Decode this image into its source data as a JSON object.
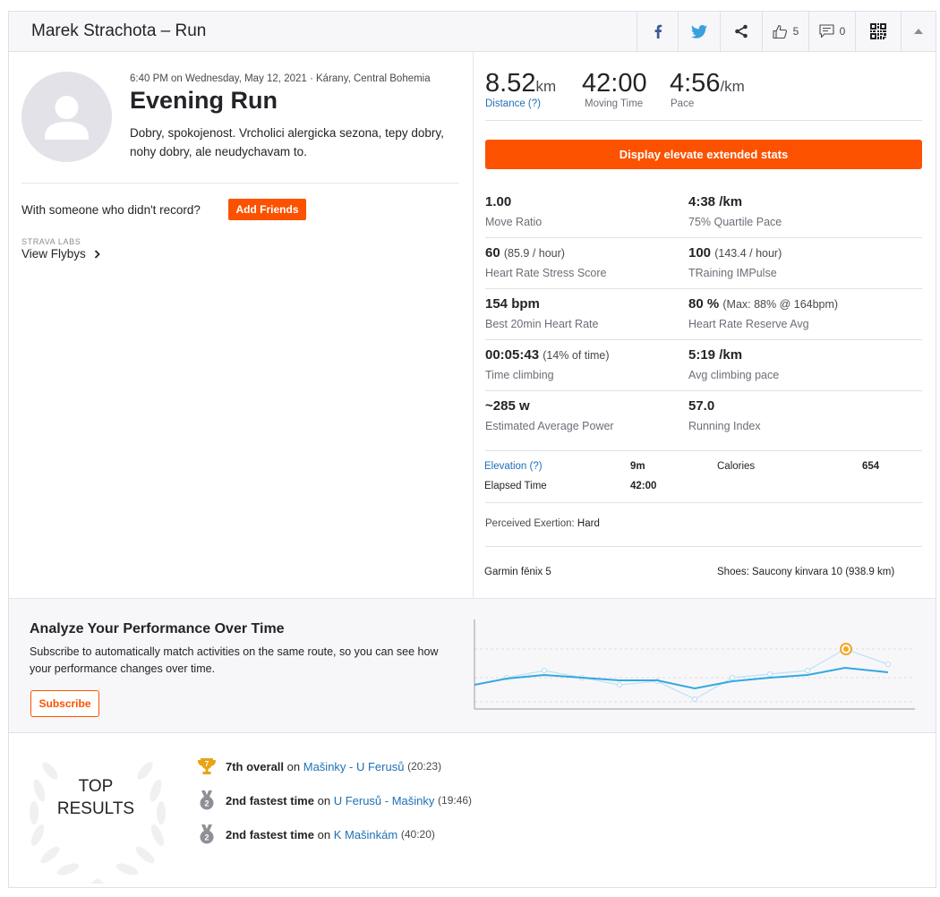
{
  "header": {
    "title": "Marek Strachota – Run",
    "kudos_count": "5",
    "comments_count": "0"
  },
  "activity": {
    "time": "6:40 PM",
    "on": "on",
    "date": "Wednesday, May 12, 2021",
    "location": "· Kárany, Central Bohemia",
    "title": "Evening Run",
    "description": "Dobry, spokojenost. Vrcholici alergicka sezona, tepy dobry, nohy dobry, ale neudychavam to."
  },
  "friends": {
    "prompt": "With someone who didn't record?",
    "add_button": "Add Friends",
    "labs_label": "STRAVA LABS",
    "flybys_link": "View Flybys"
  },
  "primary_stats": [
    {
      "value": "8.52",
      "unit": "km",
      "label": "Distance (?)"
    },
    {
      "value": "42:00",
      "unit": "",
      "label": "Moving Time"
    },
    {
      "value": "4:56",
      "unit": "/km",
      "label": "Pace"
    }
  ],
  "elevate_button": "Display elevate extended stats",
  "extended_stats": [
    {
      "value": "1.00",
      "sub": "",
      "label": "Move Ratio"
    },
    {
      "value": "4:38 /km",
      "sub": "",
      "label": "75% Quartile Pace"
    },
    {
      "value": "60",
      "sub": "(85.9 / hour)",
      "label": "Heart Rate Stress Score"
    },
    {
      "value": "100",
      "sub": "(143.4 / hour)",
      "label": "TRaining IMPulse"
    },
    {
      "value": "154 bpm",
      "sub": "",
      "label": "Best 20min Heart Rate"
    },
    {
      "value": "80 %",
      "sub": "(Max: 88% @ 164bpm)",
      "label": "Heart Rate Reserve Avg"
    },
    {
      "value": "00:05:43",
      "sub": "(14% of time)",
      "label": "Time climbing"
    },
    {
      "value": "5:19 /km",
      "sub": "",
      "label": "Avg climbing pace"
    },
    {
      "value": "~285 w",
      "sub": "",
      "label": "Estimated Average Power"
    },
    {
      "value": "57.0",
      "sub": "",
      "label": "Running Index"
    }
  ],
  "secondary_stats": {
    "elevation_label": "Elevation (?)",
    "elevation_value": "9m",
    "calories_label": "Calories",
    "calories_value": "654",
    "elapsed_label": "Elapsed Time",
    "elapsed_value": "42:00",
    "exertion_label": "Perceived Exertion:",
    "exertion_value": "Hard",
    "device": "Garmin fēnix 5",
    "shoes": "Shoes: Saucony kinvara 10 (938.9 km)"
  },
  "analyze": {
    "title": "Analyze Your Performance Over Time",
    "text": "Subscribe to automatically match activities on the same route, so you can see how your performance changes over time.",
    "button": "Subscribe"
  },
  "top_results": {
    "heading_line1": "TOP",
    "heading_line2": "RESULTS",
    "items": [
      {
        "badge": "7",
        "rank": "7th overall",
        "on": "on",
        "segment": "Mašinky - U Ferusů",
        "time": "(20:23)",
        "badge_type": "trophy"
      },
      {
        "badge": "2",
        "rank": "2nd fastest time",
        "on": "on",
        "segment": "U Ferusů - Mašinky",
        "time": "(19:46)",
        "badge_type": "medal"
      },
      {
        "badge": "2",
        "rank": "2nd fastest time",
        "on": "on",
        "segment": "K Mašinkám",
        "time": "(40:20)",
        "badge_type": "medal"
      }
    ]
  },
  "colors": {
    "brand": "#fc5200",
    "link": "#1e70b6",
    "trophy": "#e8a317",
    "medal": "#8f8f97"
  },
  "icons": [
    "facebook-icon",
    "twitter-icon",
    "share-icon",
    "kudos-icon",
    "comment-icon",
    "qr-code-icon",
    "collapse-icon",
    "wreath-icon"
  ]
}
